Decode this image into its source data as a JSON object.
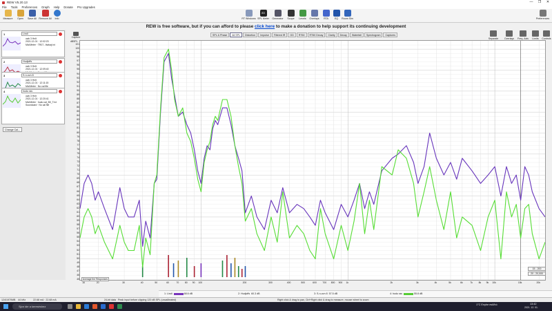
{
  "window": {
    "title": "REW V5.20.13",
    "controls": [
      "—",
      "❐",
      "✕"
    ]
  },
  "menu": [
    "File",
    "Tools",
    "Preferences",
    "Graph",
    "Help",
    "Donate",
    "Pro Upgrades"
  ],
  "toolbar": {
    "left": [
      "Measure",
      "Open",
      "Save All",
      "Remove All",
      "Info"
    ],
    "center": [
      "RT Windows",
      "SPL Meter",
      "Generator",
      "Scope",
      "Levels",
      "Overlays",
      "RTA",
      "EQ",
      "Room Sim"
    ],
    "spl_value": "83",
    "right": [
      "Preferences"
    ]
  },
  "banner": {
    "before": "REW is free software, but if you can afford to please ",
    "link": "click here",
    "after": " to make a donation to help support its continuing development"
  },
  "tabs": [
    {
      "label": "SPL & Phase",
      "active": false
    },
    {
      "label": "All SPL",
      "active": true
    },
    {
      "label": "Distortion",
      "active": false
    },
    {
      "label": "Impulse",
      "active": false
    },
    {
      "label": "Filtered IR",
      "active": false
    },
    {
      "label": "GD",
      "active": false
    },
    {
      "label": "RT60",
      "active": false
    },
    {
      "label": "RT60 Decay",
      "active": false
    },
    {
      "label": "Clarity",
      "active": false
    },
    {
      "label": "Decay",
      "active": false
    },
    {
      "label": "Waterfall",
      "active": false
    },
    {
      "label": "Spectrogram",
      "active": false
    },
    {
      "label": "Captures",
      "active": false
    }
  ],
  "right_tools": [
    "Separate",
    "Overlays",
    "Freq. Axis",
    "Limits",
    "Controls"
  ],
  "left_panel": {
    "collapse_label": "Collapse",
    "change_cal_label": "Change Cal...",
    "measurements": [
      {
        "num": "1",
        "name": "Lindi",
        "info": [
          "uwk 3 Hnlt",
          "2021-12-01 · 12:02:23",
          "Mic/Meter · TR07...ftwkwj.txt"
        ],
        "color": "#7733bb"
      },
      {
        "num": "2",
        "name": "Hudjoffs",
        "info": [
          "uwk 3 Hnlt",
          "2021-12-01 · 12:09:40",
          "Mic/Meter · No cal file"
        ],
        "color": "#bb3344"
      },
      {
        "num": "3",
        "name": "S-n-ovn 8",
        "info": [
          "uwk 3 Hnlt",
          "2021-12-01 · 12:11:15",
          "Mic/Meter · No cal file"
        ],
        "color": "#228844"
      },
      {
        "num": "4",
        "name": "hudu ras",
        "info": [
          "uwk 3 Hnlr",
          "2021-12-01 · 12:20:41",
          "Mic/Meter · hudu cal_B0_T.txt",
          "Soundcard · No cal file"
        ],
        "color": "#55cc33"
      }
    ]
  },
  "graph": {
    "capture_label": "Capture",
    "y_ticks": [
      "101",
      "100",
      "99",
      "98",
      "97",
      "96",
      "95",
      "94",
      "93",
      "92",
      "91",
      "90",
      "89",
      "88",
      "87",
      "86",
      "85",
      "84",
      "83",
      "82",
      "81",
      "80",
      "79",
      "78",
      "77",
      "76",
      "75",
      "74",
      "73",
      "72",
      "71",
      "70",
      "69",
      "68",
      "67",
      "66",
      "65",
      "64",
      "63",
      "62",
      "61",
      "60",
      "59",
      "58",
      "57",
      "56",
      "55",
      "54",
      "53",
      "52",
      "51",
      "50",
      "49",
      "48",
      "47",
      "46",
      "45"
    ],
    "x_ticks": [
      "16",
      "20",
      "30",
      "40",
      "50",
      "60",
      "70",
      "80",
      "90",
      "100",
      "200",
      "300",
      "400",
      "500",
      "600",
      "700",
      "800",
      "900",
      "1k",
      "2k",
      "3k",
      "4k",
      "5k",
      "6k",
      "7k",
      "8k",
      "9k",
      "10k",
      "15k",
      "20k"
    ],
    "unit_label": "dBSPL",
    "average_button": "Average the Responses",
    "range_buttons": [
      "15 - 200",
      "20 - 20,000"
    ]
  },
  "legend": [
    {
      "label": "1: Lindi",
      "value": "68.6 dB",
      "color": "#7733bb"
    },
    {
      "label": "2: Hudjoffs",
      "value": "60.3 dB",
      "color": "#bb3344"
    },
    {
      "label": "3: S-n-ovn 8",
      "value": "57.5 dB",
      "color": "#228844"
    },
    {
      "label": "4: hudu ras",
      "value": "55.8 dB",
      "color": "#55cc33"
    }
  ],
  "status": {
    "mem": "124/1970MB",
    "rate": "44 kHz",
    "level": "22.68 mA · 22.68 mA",
    "bits": "24-bit data",
    "warning": "Peak input before clipping 120 dB SPL (uncalibrated)",
    "hint": "Right click & drag to pan, Ctrl+Right click & drag to measure, mouse wheel to zoom"
  },
  "taskbar": {
    "search_placeholder": "Sjon ide a kereséshez",
    "weather": "1°C  Enyhe eső/hó",
    "time": "13:42",
    "date": "2021. 12. 01."
  },
  "chart_data": {
    "type": "line",
    "xlabel": "",
    "ylabel": "dBSPL",
    "x_scale": "log",
    "xlim": [
      15,
      22000
    ],
    "ylim": [
      45,
      102
    ],
    "grid": true,
    "series": [
      {
        "name": "1: Lindi",
        "color": "#6633bb",
        "x": [
          15,
          16,
          17,
          18,
          19,
          20,
          22,
          25,
          28,
          30,
          32,
          35,
          38,
          40,
          42,
          45,
          48,
          50,
          53,
          56,
          60,
          63,
          66,
          70,
          75,
          80,
          85,
          90,
          95,
          100,
          105,
          110,
          115,
          120,
          125,
          130,
          140,
          150,
          160,
          170,
          180,
          190,
          200,
          220,
          240,
          270,
          300,
          330,
          360,
          400,
          450,
          500,
          550,
          600,
          650,
          700,
          800,
          900,
          1000,
          1100,
          1200,
          1300,
          1400,
          1500,
          1700,
          2000,
          2200,
          2500,
          2800,
          3000,
          3300,
          3600,
          4000,
          4500,
          5000,
          5500,
          6000,
          7000,
          8000,
          9000,
          10000,
          11000,
          12000,
          13000,
          14000,
          15000,
          16000,
          17000,
          18000,
          20000,
          22000
        ],
        "y": [
          62,
          68,
          70,
          68,
          64,
          66,
          62,
          57,
          67,
          62,
          60,
          60,
          64,
          53,
          59,
          55,
          68,
          69,
          85,
          97,
          99,
          93,
          89,
          84,
          85,
          82,
          80,
          76,
          71,
          68,
          74,
          77,
          76,
          81,
          83,
          82,
          86,
          86,
          82,
          77,
          74,
          71,
          61,
          65,
          60,
          57,
          64,
          61,
          67,
          61,
          63,
          62,
          60,
          58,
          64,
          61,
          57,
          63,
          60,
          64,
          68,
          62,
          66,
          63,
          71,
          74,
          75,
          77,
          73,
          68,
          72,
          80,
          74,
          70,
          73,
          69,
          74,
          71,
          68,
          70,
          72,
          65,
          72,
          68,
          70,
          64,
          72,
          70,
          66,
          62,
          60
        ]
      },
      {
        "name": "4: hudu ras",
        "color": "#55dd33",
        "x": [
          15,
          16,
          17,
          18,
          19,
          20,
          22,
          25,
          28,
          30,
          32,
          35,
          38,
          40,
          42,
          45,
          48,
          50,
          53,
          56,
          60,
          63,
          66,
          70,
          75,
          80,
          85,
          90,
          95,
          100,
          105,
          110,
          115,
          120,
          125,
          130,
          140,
          150,
          160,
          170,
          180,
          190,
          200,
          220,
          240,
          270,
          300,
          330,
          360,
          400,
          450,
          500,
          550,
          600,
          650,
          700,
          800,
          900,
          1000,
          1100,
          1200,
          1300,
          1400,
          1500,
          1700,
          2000,
          2200,
          2500,
          2800,
          3000,
          3300,
          3600,
          4000,
          4500,
          5000,
          5500,
          6000,
          7000,
          8000,
          9000,
          10000,
          11000,
          12000,
          13000,
          14000,
          15000,
          16000,
          17000,
          18000,
          20000,
          22000
        ],
        "y": [
          55,
          60,
          62,
          60,
          56,
          58,
          54,
          50,
          58,
          54,
          52,
          52,
          58,
          48,
          55,
          51,
          68,
          70,
          86,
          98,
          100,
          95,
          88,
          84,
          86,
          80,
          78,
          74,
          69,
          66,
          73,
          76,
          78,
          82,
          84,
          83,
          88,
          88,
          84,
          77,
          72,
          68,
          59,
          62,
          56,
          52,
          60,
          54,
          66,
          55,
          58,
          56,
          52,
          50,
          62,
          56,
          50,
          58,
          52,
          59,
          68,
          56,
          64,
          57,
          72,
          70,
          76,
          74,
          68,
          60,
          66,
          72,
          64,
          57,
          66,
          55,
          60,
          58,
          52,
          60,
          64,
          50,
          66,
          60,
          63,
          55,
          62,
          63,
          56,
          50,
          54
        ]
      }
    ],
    "spectrum_bars": {
      "x": [
        40,
        60,
        65,
        70,
        80,
        90,
        100,
        140,
        150,
        160,
        170,
        180,
        190,
        200
      ],
      "heights": [
        4,
        8,
        5,
        6,
        7,
        4,
        5,
        6,
        8,
        5,
        7,
        4,
        3,
        4
      ]
    }
  }
}
